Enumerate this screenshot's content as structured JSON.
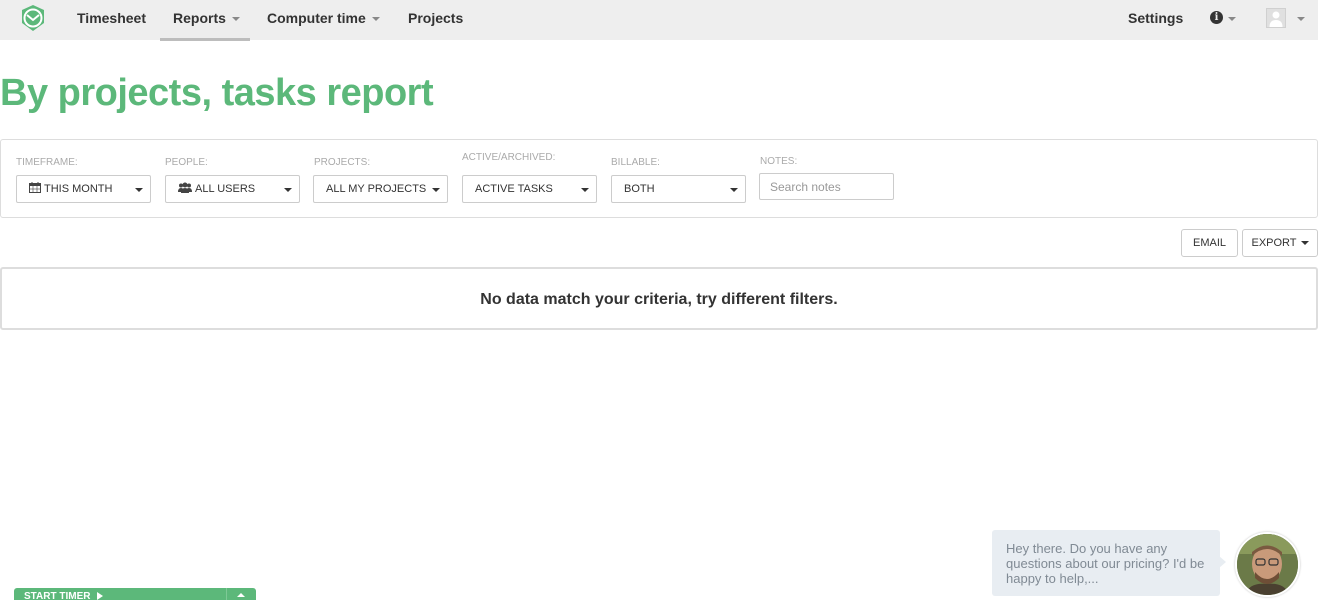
{
  "nav": {
    "items": [
      {
        "label": "Timesheet"
      },
      {
        "label": "Reports"
      },
      {
        "label": "Computer time"
      },
      {
        "label": "Projects"
      }
    ],
    "settings_label": "Settings"
  },
  "page": {
    "title": "By projects, tasks report"
  },
  "filters": {
    "timeframe": {
      "label": "TIMEFRAME:",
      "value": "THIS MONTH"
    },
    "people": {
      "label": "PEOPLE:",
      "value": "ALL USERS"
    },
    "projects": {
      "label": "PROJECTS:",
      "value": "ALL MY PROJECTS"
    },
    "active": {
      "label": "ACTIVE/ARCHIVED:",
      "value": "ACTIVE TASKS"
    },
    "billable": {
      "label": "BILLABLE:",
      "value": "BOTH"
    },
    "notes": {
      "label": "NOTES:",
      "placeholder": "Search notes"
    }
  },
  "actions": {
    "email_label": "EMAIL",
    "export_label": "EXPORT"
  },
  "empty_state": {
    "message": "No data match your criteria, try different filters."
  },
  "chat": {
    "message": "Hey there. Do you have any questions about our pricing? I'd be happy to help,..."
  },
  "timer": {
    "label": "START TIMER"
  },
  "colors": {
    "brand_green": "#5cb87a",
    "nav_bg": "#eeeeee",
    "border": "#dddddd"
  }
}
